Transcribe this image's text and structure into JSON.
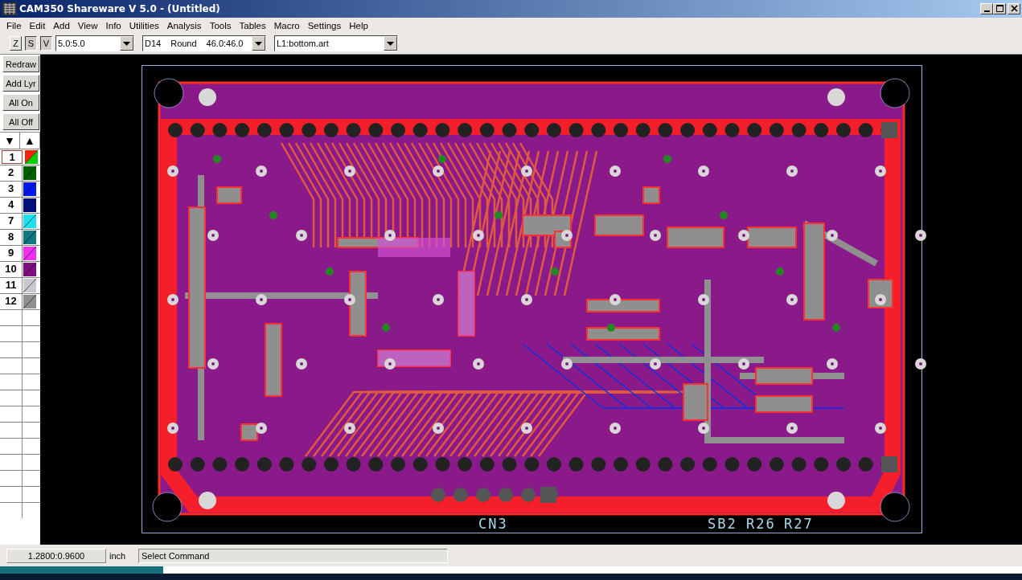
{
  "window": {
    "title": "CAM350 Shareware V 5.0 - (Untitled)"
  },
  "menu": [
    "File",
    "Edit",
    "Add",
    "View",
    "Info",
    "Utilities",
    "Analysis",
    "Tools",
    "Tables",
    "Macro",
    "Settings",
    "Help"
  ],
  "toolbar": {
    "toggles": [
      {
        "label": "Z",
        "pressed": false
      },
      {
        "label": "S",
        "pressed": true
      },
      {
        "label": "V",
        "pressed": true
      }
    ],
    "grid_combo": "5.0:5.0",
    "aperture_combo": [
      "D14",
      "Round",
      "46.0:46.0"
    ],
    "layer_combo": "L1:bottom.art"
  },
  "side_buttons": [
    "Redraw",
    "Add Lyr",
    "All On",
    "All Off"
  ],
  "arrows": [
    "▼",
    "▲"
  ],
  "layers": [
    {
      "number": "1",
      "swatch": [
        {
          "color": "#ff2010"
        },
        {
          "color": "#00d000"
        }
      ],
      "selected": true
    },
    {
      "number": "2",
      "color": "#006000",
      "selected": false
    },
    {
      "number": "3",
      "color": "#0018f0",
      "selected": false
    },
    {
      "number": "4",
      "color": "#001080",
      "selected": false
    },
    {
      "number": "7",
      "color": "#20e0f0",
      "selected": false
    },
    {
      "number": "8",
      "color": "#107880",
      "selected": false
    },
    {
      "number": "9",
      "color": "#f030f0",
      "selected": false
    },
    {
      "number": "10",
      "color": "#801080",
      "selected": false
    },
    {
      "number": "11",
      "color": "#c8c8d0",
      "selected": false
    },
    {
      "number": "12",
      "color": "#909090",
      "selected": false
    }
  ],
  "canvas": {
    "labels": [
      "CN3",
      "SB2",
      "R26",
      "R27"
    ]
  },
  "status_bar": {
    "coordinates": "1.2800:0.9600",
    "units": "inch",
    "prompt": "Select Command"
  },
  "seek_bar": {
    "level": 0.16
  }
}
